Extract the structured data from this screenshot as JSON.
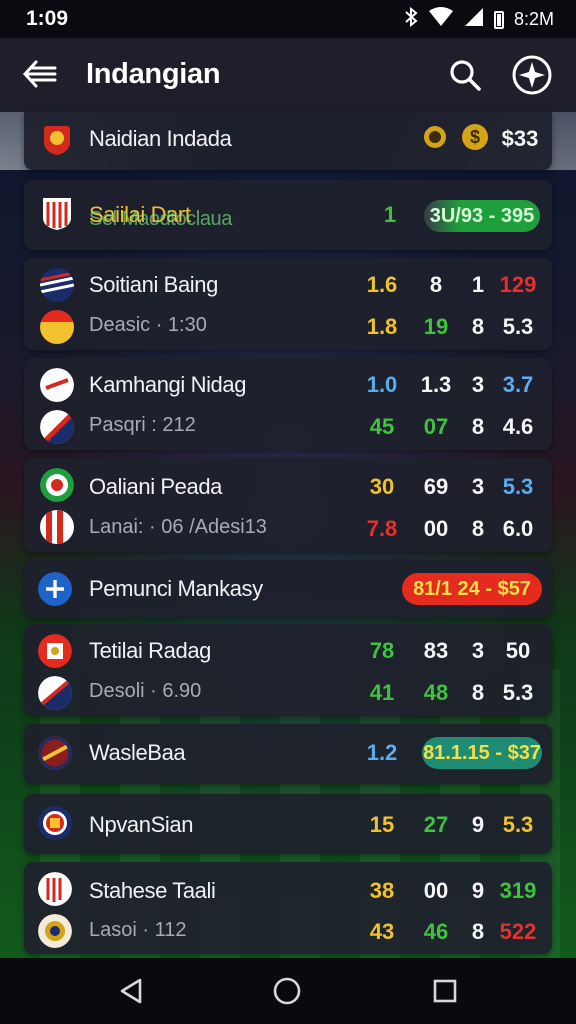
{
  "status": {
    "time": "1:09",
    "right_text": "8:2M",
    "icons": [
      "bluetooth-icon",
      "wifi-icon",
      "signal-icon",
      "battery-icon"
    ]
  },
  "appbar": {
    "title": "Indangian",
    "icons": [
      "back-arrow-icon",
      "search-icon",
      "compass-icon"
    ]
  },
  "matches": [
    {
      "team": "Naidian Indada",
      "icon2": "$",
      "value": "$33"
    },
    {
      "team": "Saiilai Dart",
      "overlay": "Sel Maodtoclaua",
      "num": "1",
      "pill": "3U/93 - 395"
    },
    {
      "team": "Soitiani Baing",
      "sub": "Deasic · 1:30",
      "row1": [
        "1.6",
        "8",
        "1",
        "129"
      ],
      "row2": [
        "1.8",
        "19",
        "8",
        "5.3"
      ]
    },
    {
      "team": "Kamhangi Nidag",
      "sub": "Pasqri : 212",
      "row1": [
        "1.0",
        "1.3",
        "3",
        "3.7"
      ],
      "row2": [
        "45",
        "07",
        "8",
        "4.6"
      ]
    },
    {
      "team": "Oaliani Peada",
      "sub": "Lanai: · 06 /Adesi13",
      "row1": [
        "30",
        "69",
        "3",
        "5.3"
      ],
      "row2": [
        "7.8",
        "00",
        "8",
        "6.0"
      ]
    },
    {
      "team": "Pemunci Mankasy",
      "pill": "81/1 24 - $57"
    },
    {
      "team": "Tetilai Radag",
      "sub": "Desoli · 6.90",
      "row1": [
        "78",
        "83",
        "3",
        "50"
      ],
      "row2": [
        "41",
        "48",
        "8",
        "5.3"
      ]
    },
    {
      "team": "WasleBaa",
      "num": "1.2",
      "pill": "81.1.15 - $37"
    },
    {
      "team": "NpvanSian",
      "row1": [
        "15",
        "27",
        "9",
        "5.3"
      ]
    },
    {
      "team": "Stahese Taali",
      "sub": "Lasoi · 112",
      "row1": [
        "38",
        "00",
        "9",
        "319"
      ],
      "row2": [
        "43",
        "46",
        "8",
        "522"
      ]
    }
  ],
  "colors": {
    "yellow": "#f2c12e",
    "green": "#3fc33f",
    "blue": "#5aaef0",
    "red": "#e53030",
    "pill_green": "#1f9e3c",
    "pill_red": "#e52b1e",
    "pill_teal": "#1d8c72"
  },
  "navbar": {
    "icons": [
      "back-triangle-icon",
      "home-circle-icon",
      "recents-square-icon"
    ]
  }
}
